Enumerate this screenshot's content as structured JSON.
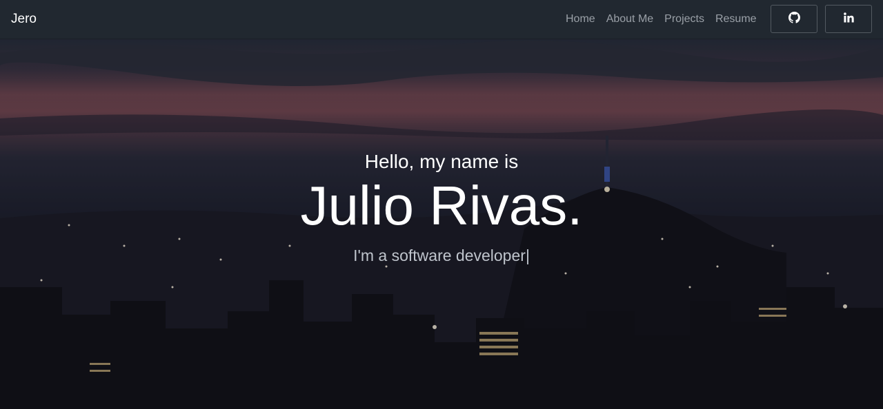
{
  "navbar": {
    "brand": "Jero",
    "links": [
      {
        "label": "Home"
      },
      {
        "label": "About Me"
      },
      {
        "label": "Projects"
      },
      {
        "label": "Resume"
      }
    ],
    "social": [
      {
        "icon": "github-icon"
      },
      {
        "icon": "linkedin-icon"
      }
    ]
  },
  "hero": {
    "greeting": "Hello, my name is",
    "name": "Julio Rivas.",
    "tagline": "I'm a software developer",
    "cursor": "|"
  },
  "colors": {
    "navbar_bg": "#212830",
    "link": "#9aa0a7",
    "text": "#ffffff"
  }
}
